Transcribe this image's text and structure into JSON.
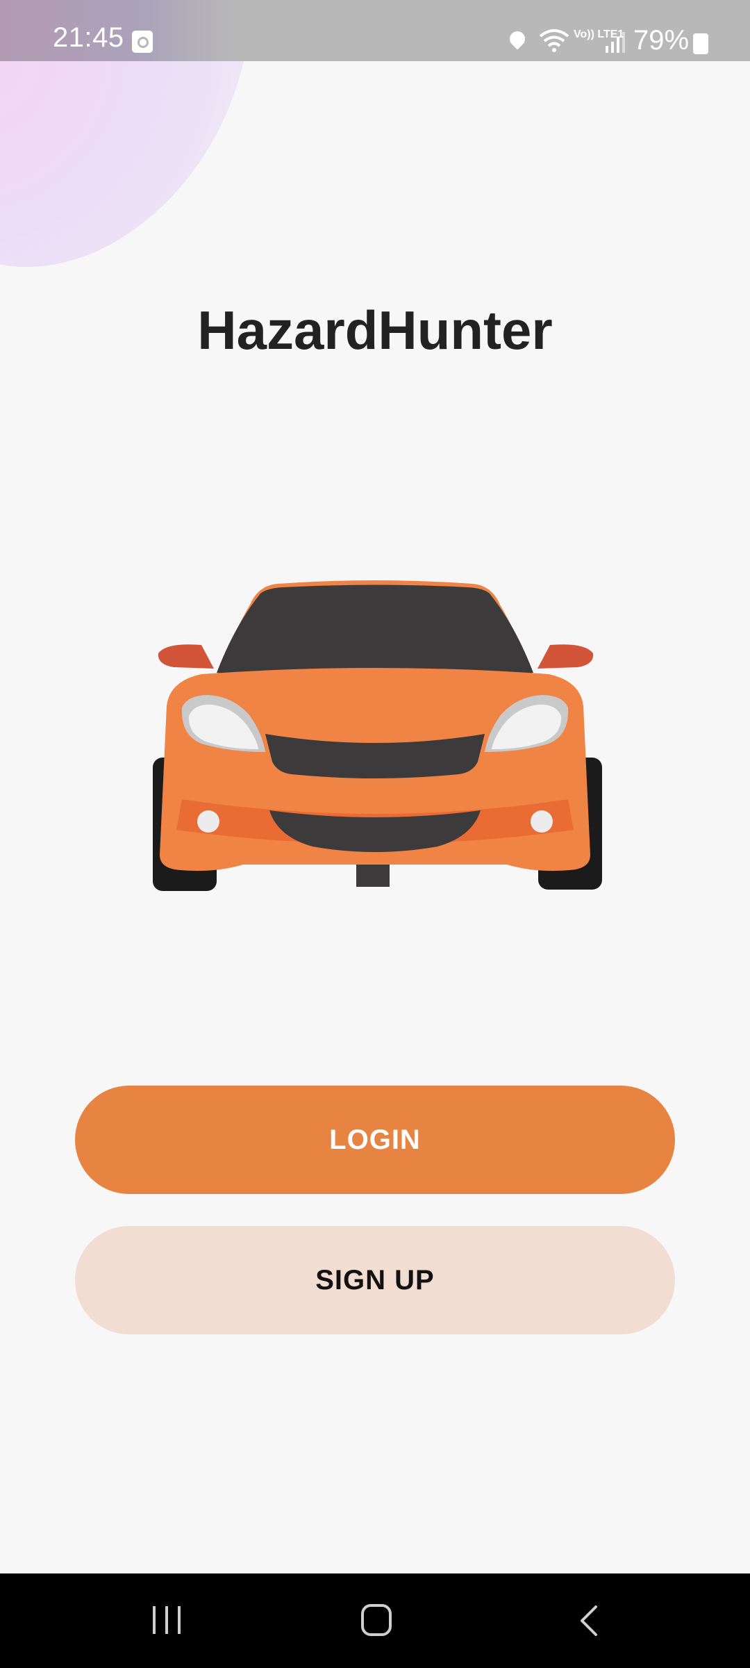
{
  "status_bar": {
    "time": "21:45",
    "battery": "79%",
    "network_label": "Vo)) LTE1",
    "icons": [
      "alarm-icon",
      "location-icon",
      "wifi-icon",
      "volte-icon",
      "signal-icon",
      "battery-charging-icon"
    ]
  },
  "app": {
    "title": "HazardHunter",
    "illustration": "car-front-icon"
  },
  "actions": {
    "login_label": "LOGIN",
    "signup_label": "SIGN UP"
  },
  "nav_bar": {
    "icons": [
      "recent-apps-icon",
      "home-icon",
      "back-icon"
    ]
  },
  "colors": {
    "accent": "#e78442",
    "accent_light": "#f1ddd1",
    "background": "#f7f7f7",
    "car_body": "#ef8444",
    "car_dark": "#3d3a3b"
  }
}
